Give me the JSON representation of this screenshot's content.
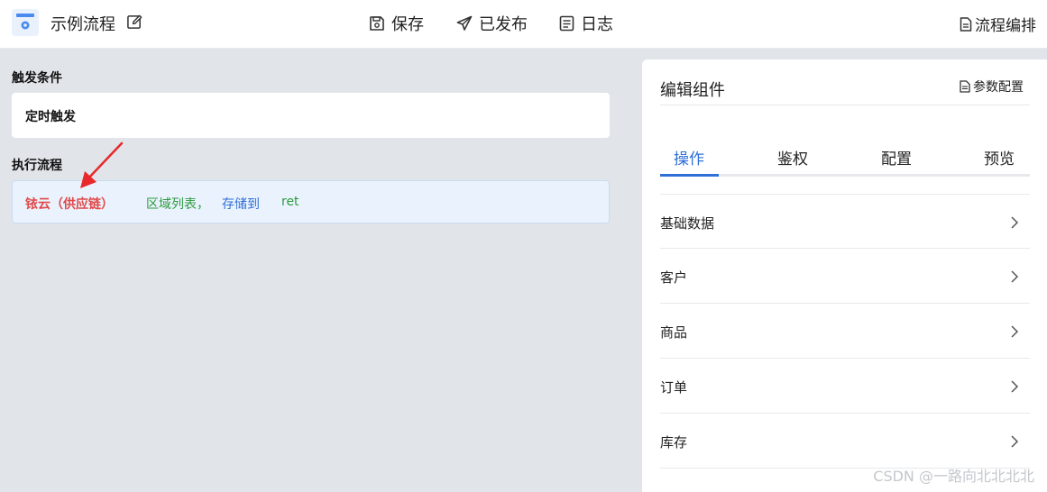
{
  "header": {
    "title": "示例流程",
    "save_label": "保存",
    "publish_label": "已发布",
    "log_label": "日志",
    "flow_edit_label": "流程编排"
  },
  "trigger": {
    "section_title": "触发条件",
    "card_label": "定时触发"
  },
  "flow": {
    "section_title": "执行流程",
    "step": {
      "service": "铱云（供应链）",
      "operation": "区域列表，",
      "store_text": "存储到",
      "variable": "ret"
    }
  },
  "editor": {
    "title": "编辑组件",
    "param_label": "参数配置",
    "tabs": [
      "操作",
      "鉴权",
      "配置",
      "预览"
    ],
    "active_tab": 0,
    "categories": [
      "基础数据",
      "客户",
      "商品",
      "订单",
      "库存"
    ]
  },
  "watermark": "CSDN @一路向北北北北",
  "colors": {
    "accent": "#2f6fd6",
    "service_red": "#e04848",
    "op_green": "#2e9a3e"
  }
}
